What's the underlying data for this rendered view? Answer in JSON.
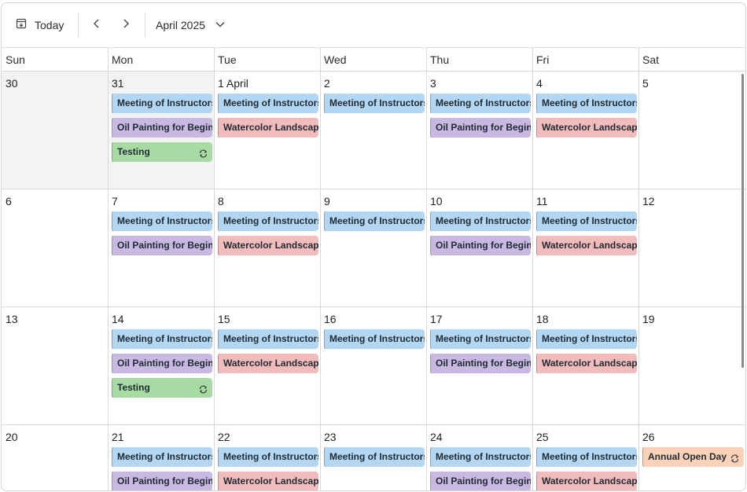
{
  "toolbar": {
    "today_label": "Today",
    "month_label": "April 2025",
    "icons": {
      "today": "calendar-today-icon",
      "prev": "chevron-left-icon",
      "next": "chevron-right-icon",
      "month_dropdown": "chevron-down-icon"
    }
  },
  "weekdays": [
    "Sun",
    "Mon",
    "Tue",
    "Wed",
    "Thu",
    "Fri",
    "Sat"
  ],
  "colors": {
    "blue": "#b3d6f2",
    "purple": "#c9b8e2",
    "pink": "#f2bcbc",
    "green": "#a8dba3",
    "peach": "#fbd2b8",
    "out_of_month_day": "#f3f3f3"
  },
  "weeks": [
    {
      "days": [
        {
          "label": "30",
          "out_of_month": true,
          "events": []
        },
        {
          "label": "31",
          "out_of_month": true,
          "events": [
            {
              "title": "Meeting of Instructors",
              "color": "blue"
            },
            {
              "title": "Oil Painting for Beginners",
              "color": "purple"
            },
            {
              "title": "Testing",
              "color": "green",
              "recurring": true
            }
          ]
        },
        {
          "label": "1 April",
          "events": [
            {
              "title": "Meeting of Instructors",
              "color": "blue"
            },
            {
              "title": "Watercolor Landscapes",
              "color": "pink"
            }
          ]
        },
        {
          "label": "2",
          "events": [
            {
              "title": "Meeting of Instructors",
              "color": "blue"
            }
          ]
        },
        {
          "label": "3",
          "events": [
            {
              "title": "Meeting of Instructors",
              "color": "blue"
            },
            {
              "title": "Oil Painting for Beginners",
              "color": "purple"
            }
          ]
        },
        {
          "label": "4",
          "events": [
            {
              "title": "Meeting of Instructors",
              "color": "blue"
            },
            {
              "title": "Watercolor Landscapes",
              "color": "pink"
            }
          ]
        },
        {
          "label": "5",
          "events": []
        }
      ]
    },
    {
      "days": [
        {
          "label": "6",
          "events": []
        },
        {
          "label": "7",
          "events": [
            {
              "title": "Meeting of Instructors",
              "color": "blue"
            },
            {
              "title": "Oil Painting for Beginners",
              "color": "purple"
            }
          ]
        },
        {
          "label": "8",
          "events": [
            {
              "title": "Meeting of Instructors",
              "color": "blue"
            },
            {
              "title": "Watercolor Landscapes",
              "color": "pink"
            }
          ]
        },
        {
          "label": "9",
          "events": [
            {
              "title": "Meeting of Instructors",
              "color": "blue"
            }
          ]
        },
        {
          "label": "10",
          "events": [
            {
              "title": "Meeting of Instructors",
              "color": "blue"
            },
            {
              "title": "Oil Painting for Beginners",
              "color": "purple"
            }
          ]
        },
        {
          "label": "11",
          "events": [
            {
              "title": "Meeting of Instructors",
              "color": "blue"
            },
            {
              "title": "Watercolor Landscapes",
              "color": "pink"
            }
          ]
        },
        {
          "label": "12",
          "events": []
        }
      ]
    },
    {
      "days": [
        {
          "label": "13",
          "events": []
        },
        {
          "label": "14",
          "events": [
            {
              "title": "Meeting of Instructors",
              "color": "blue"
            },
            {
              "title": "Oil Painting for Beginners",
              "color": "purple"
            },
            {
              "title": "Testing",
              "color": "green",
              "recurring": true
            }
          ]
        },
        {
          "label": "15",
          "events": [
            {
              "title": "Meeting of Instructors",
              "color": "blue"
            },
            {
              "title": "Watercolor Landscapes",
              "color": "pink"
            }
          ]
        },
        {
          "label": "16",
          "events": [
            {
              "title": "Meeting of Instructors",
              "color": "blue"
            }
          ]
        },
        {
          "label": "17",
          "events": [
            {
              "title": "Meeting of Instructors",
              "color": "blue"
            },
            {
              "title": "Oil Painting for Beginners",
              "color": "purple"
            }
          ]
        },
        {
          "label": "18",
          "events": [
            {
              "title": "Meeting of Instructors",
              "color": "blue"
            },
            {
              "title": "Watercolor Landscapes",
              "color": "pink"
            }
          ]
        },
        {
          "label": "19",
          "events": []
        }
      ]
    },
    {
      "days": [
        {
          "label": "20",
          "events": []
        },
        {
          "label": "21",
          "events": [
            {
              "title": "Meeting of Instructors",
              "color": "blue"
            },
            {
              "title": "Oil Painting for Beginners",
              "color": "purple"
            }
          ]
        },
        {
          "label": "22",
          "events": [
            {
              "title": "Meeting of Instructors",
              "color": "blue"
            },
            {
              "title": "Watercolor Landscapes",
              "color": "pink"
            }
          ]
        },
        {
          "label": "23",
          "events": [
            {
              "title": "Meeting of Instructors",
              "color": "blue"
            }
          ]
        },
        {
          "label": "24",
          "events": [
            {
              "title": "Meeting of Instructors",
              "color": "blue"
            },
            {
              "title": "Oil Painting for Beginners",
              "color": "purple"
            }
          ]
        },
        {
          "label": "25",
          "events": [
            {
              "title": "Meeting of Instructors",
              "color": "blue"
            },
            {
              "title": "Watercolor Landscapes",
              "color": "pink"
            }
          ]
        },
        {
          "label": "26",
          "events": [
            {
              "title": "Annual Open Day",
              "color": "peach",
              "recurring": true
            }
          ]
        }
      ]
    }
  ]
}
